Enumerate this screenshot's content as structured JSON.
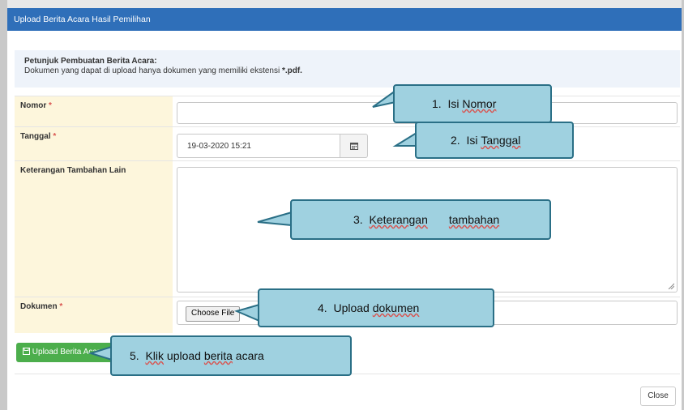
{
  "modal": {
    "title": "Upload Berita Acara Hasil Pemilihan"
  },
  "notice": {
    "heading": "Petunjuk Pembuatan Berita Acara:",
    "text_prefix": "Dokumen yang dapat di upload hanya dokumen yang memiliki ekstensi ",
    "text_ext": "*.pdf."
  },
  "form": {
    "nomor": {
      "label": "Nomor",
      "required": "*",
      "value": ""
    },
    "tanggal": {
      "label": "Tanggal",
      "required": "*",
      "value": "19-03-2020 15:21"
    },
    "keterangan": {
      "label": "Keterangan Tambahan Lain",
      "value": ""
    },
    "dokumen": {
      "label": "Dokumen",
      "required": "*",
      "choose_label": "Choose File"
    }
  },
  "buttons": {
    "upload_label": "Upload Berita Acara",
    "close_label": "Close"
  },
  "callouts": [
    {
      "num": "1.",
      "text": "Isi",
      "underlined": "Nomor",
      "after": ""
    },
    {
      "num": "2.",
      "text": "Isi",
      "underlined": "Tanggal",
      "after": ""
    },
    {
      "num": "3.",
      "text": "",
      "underlined": "Keterangan",
      "after": "",
      "underlined2": "tambahan"
    },
    {
      "num": "4.",
      "text": "Upload",
      "underlined": "dokumen",
      "after": ""
    },
    {
      "num": "5.",
      "text": "",
      "underlined": "Klik",
      "after": "upload",
      "underlined2": "berita",
      "tail": "acara"
    }
  ],
  "colors": {
    "header": "#2f6fb9",
    "label_bg": "#fdf6dc",
    "notice_bg": "#eef3fa",
    "upload_button": "#4cae4c",
    "callout_fill": "#9fd1e0",
    "callout_border": "#2a6f86",
    "required": "#d9534f"
  },
  "icons": [
    "calendar-icon",
    "save-icon",
    "resize-handle-icon"
  ]
}
